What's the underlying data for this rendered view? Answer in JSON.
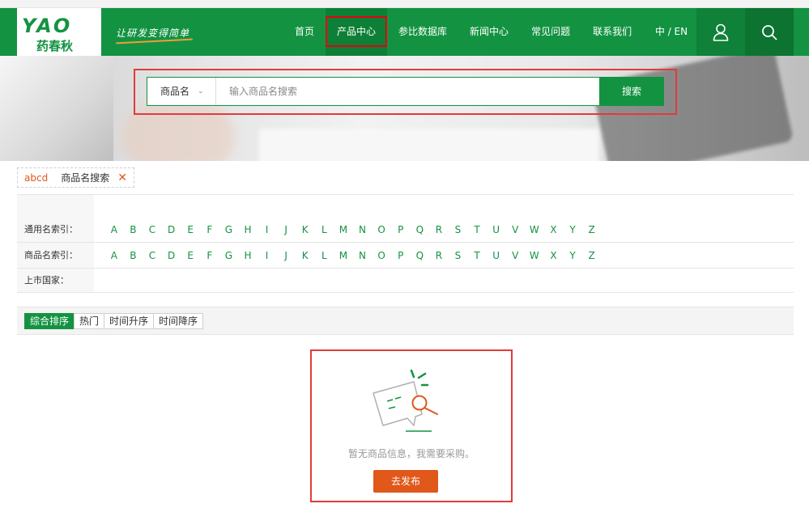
{
  "header": {
    "logo_mark": "YAO",
    "logo_sub": "药春秋",
    "slogan": "让研发变得简单",
    "nav": [
      {
        "label": "首页",
        "active": false
      },
      {
        "label": "产品中心",
        "active": true
      },
      {
        "label": "参比数据库",
        "active": false
      },
      {
        "label": "新闻中心",
        "active": false
      },
      {
        "label": "常见问题",
        "active": false
      },
      {
        "label": "联系我们",
        "active": false
      }
    ],
    "lang": "中 / EN",
    "icons": {
      "user": "user-icon",
      "search": "search-icon"
    }
  },
  "search": {
    "type_selected": "商品名",
    "placeholder": "输入商品名搜索",
    "value": "",
    "submit_label": "搜索"
  },
  "filter_tag": {
    "keyword": "abcd",
    "type": "商品名搜索",
    "remove_icon": "close-icon"
  },
  "index": {
    "generic_label": "通用名索引：",
    "trade_label": "商品名索引：",
    "country_label": "上市国家：",
    "letters": [
      "A",
      "B",
      "C",
      "D",
      "E",
      "F",
      "G",
      "H",
      "I",
      "J",
      "K",
      "L",
      "M",
      "N",
      "O",
      "P",
      "Q",
      "R",
      "S",
      "T",
      "U",
      "V",
      "W",
      "X",
      "Y",
      "Z"
    ]
  },
  "sort": {
    "tabs": [
      {
        "label": "综合排序",
        "active": true
      },
      {
        "label": "热门",
        "active": false
      },
      {
        "label": "时间升序",
        "active": false
      },
      {
        "label": "时间降序",
        "active": false
      }
    ]
  },
  "empty": {
    "message": "暂无商品信息，我需要采购。",
    "button_label": "去发布",
    "illustration": "no-results-magnifier-icon"
  },
  "colors": {
    "brand_green": "#139341",
    "accent_orange": "#e0581a",
    "highlight_red": "#e23b3b"
  }
}
